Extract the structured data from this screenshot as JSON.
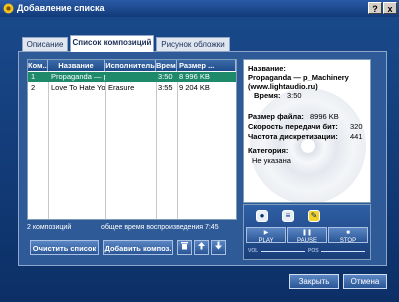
{
  "window": {
    "title": "Добавление списка",
    "help": "?",
    "close": "x"
  },
  "tabs": [
    {
      "label": "Описание"
    },
    {
      "label": "Список композиций"
    },
    {
      "label": "Рисунок обложки"
    }
  ],
  "table": {
    "columns": [
      "Ком...",
      "Название",
      "Исполнитель",
      "Время",
      "Размер ..."
    ],
    "rows": [
      {
        "num": "1",
        "title": "Propaganda — p",
        "artist": "",
        "time": "3:50",
        "size": "8 996 KB",
        "selected": true
      },
      {
        "num": "2",
        "title": "Love To Hate You",
        "artist": "Erasure",
        "time": "3:55",
        "size": "9 204 KB",
        "selected": false
      }
    ]
  },
  "status": {
    "count": "2 композиций",
    "total": "общее время воспроизведения 7:45"
  },
  "buttons": {
    "clear": "Очистить список",
    "add": "Добавить композ.",
    "delete_icon": "trash-icon",
    "up_icon": "arrow-up-icon",
    "down_icon": "arrow-down-icon"
  },
  "info": {
    "name_label": "Название:",
    "name_value": "Propaganda — p_Machinery",
    "source": "(www.lightaudio.ru)",
    "time_label": "Время:",
    "time_value": "3:50",
    "size_label": "Размер файла:",
    "size_value": "8996 KB",
    "bitrate_label": "Скорость передачи бит:",
    "bitrate_value": "320",
    "freq_label": "Частота дискретизации:",
    "freq_value": "441",
    "category_label": "Категория:",
    "category_value": "Не указана"
  },
  "player": {
    "play": "PLAY",
    "pause": "PAUSE",
    "stop": "STOP",
    "vol": "VOL",
    "pos": "POS"
  },
  "footer": {
    "close": "Закрыть",
    "cancel": "Отмена"
  }
}
